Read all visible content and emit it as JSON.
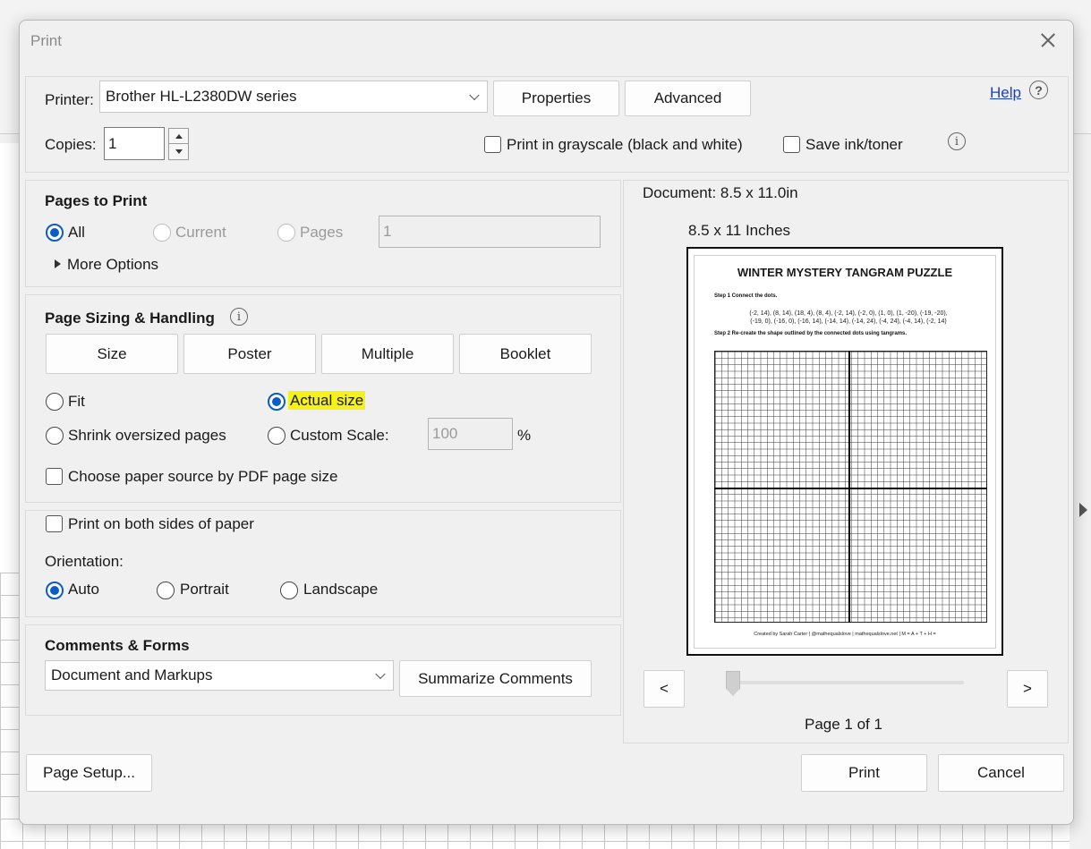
{
  "dialog": {
    "title": "Print",
    "printer_label": "Printer:",
    "printer_value": "Brother HL-L2380DW series",
    "properties_button": "Properties",
    "advanced_button": "Advanced",
    "help_link": "Help",
    "copies_label": "Copies:",
    "copies_value": "1",
    "grayscale_label": "Print in grayscale (black and white)",
    "save_ink_label": "Save ink/toner"
  },
  "pages_to_print": {
    "heading": "Pages to Print",
    "all": "All",
    "current": "Current",
    "pages": "Pages",
    "pages_value": "1",
    "more_options": "More Options"
  },
  "sizing": {
    "heading": "Page Sizing & Handling",
    "tabs": [
      "Size",
      "Poster",
      "Multiple",
      "Booklet"
    ],
    "fit": "Fit",
    "actual_size": "Actual size",
    "shrink": "Shrink oversized pages",
    "custom_scale": "Custom Scale:",
    "scale_value": "100",
    "percent": "%",
    "paper_source": "Choose paper source by PDF page size"
  },
  "duplex": {
    "both_sides": "Print on both sides of paper",
    "orientation_label": "Orientation:",
    "auto": "Auto",
    "portrait": "Portrait",
    "landscape": "Landscape"
  },
  "comments": {
    "heading": "Comments & Forms",
    "value": "Document and Markups",
    "summarize_button": "Summarize Comments"
  },
  "preview": {
    "document_size": "Document: 8.5 x 11.0in",
    "paper_size": "8.5 x 11 Inches",
    "prev": "<",
    "next": ">",
    "page_indicator": "Page 1 of 1",
    "sheet": {
      "title": "WINTER MYSTERY TANGRAM PUZZLE",
      "step1": "Step 1 Connect the dots.",
      "coords_line1": "(-2, 14), (8, 14), (18, 4), (8, 4), (-2, 14), (-2, 0), (1, 0), (1, -20), (-19, -20),",
      "coords_line2": "(-19, 0), (-16, 0), (-16, 14), (-14, 14), (-14, 24), (-4, 24), (-4, 14), (-2, 14)",
      "step2": "Step 2 Re-create the shape outlined by the connected dots using tangrams.",
      "footer": "Created by Sarah Carter | @mathequalslove | mathequalslove.net | M = A + T + H ="
    }
  },
  "footer": {
    "page_setup": "Page Setup...",
    "print": "Print",
    "cancel": "Cancel"
  },
  "colors": {
    "accent": "#0a5cc6",
    "highlight": "#f4f21a",
    "link": "#1a3fcc"
  }
}
